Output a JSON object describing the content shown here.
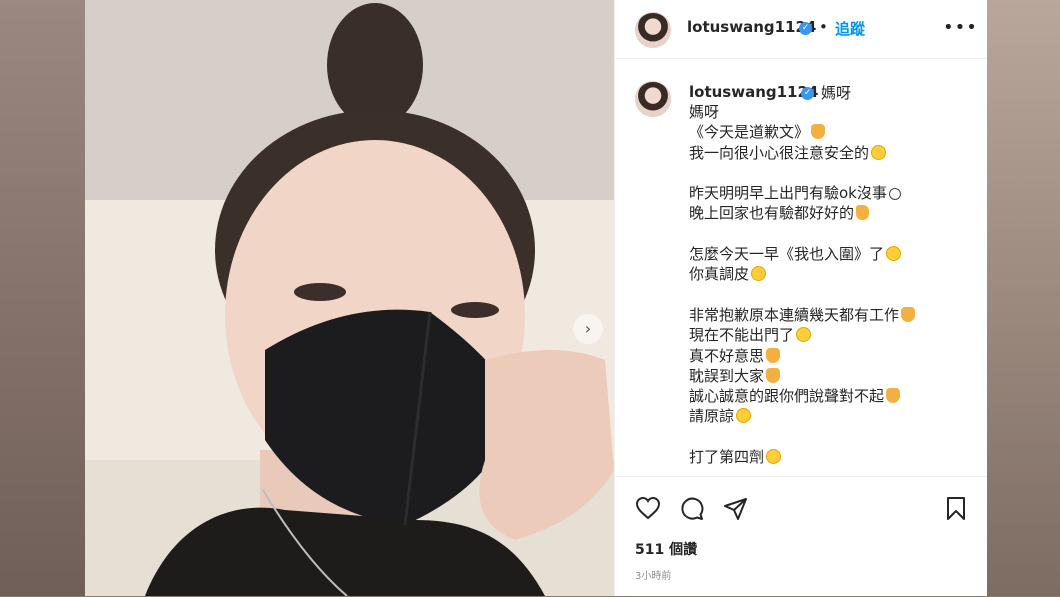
{
  "post": {
    "username": "lotuswang1124",
    "follow_label": "追蹤",
    "dot": "•",
    "more_label": "•••",
    "caption_first": "媽呀",
    "caption_lines": [
      {
        "text": "媽呀",
        "emoji": ""
      },
      {
        "text": "《今天是道歉文》",
        "emoji": "pray"
      },
      {
        "text": "我一向很小心很注意安全的",
        "emoji": "face"
      },
      {
        "text": "",
        "emoji": ""
      },
      {
        "text": "昨天明明早上出門有驗ok沒事",
        "emoji": "smile"
      },
      {
        "text": "晚上回家也有驗都好好的",
        "emoji": "ok"
      },
      {
        "text": "",
        "emoji": ""
      },
      {
        "text": "怎麼今天一早《我也入圍》了",
        "emoji": "face"
      },
      {
        "text": "你真調皮",
        "emoji": "face"
      },
      {
        "text": "",
        "emoji": ""
      },
      {
        "text": "非常抱歉原本連續幾天都有工作",
        "emoji": "pray"
      },
      {
        "text": "現在不能出門了",
        "emoji": "face"
      },
      {
        "text": "真不好意思",
        "emoji": "pray"
      },
      {
        "text": "耽誤到大家",
        "emoji": "pray"
      },
      {
        "text": "誠心誠意的跟你們說聲對不起",
        "emoji": "pray"
      },
      {
        "text": "請原諒",
        "emoji": "face"
      },
      {
        "text": "",
        "emoji": ""
      },
      {
        "text": "打了第四劑",
        "emoji": "face"
      }
    ],
    "likes": "511 個讚",
    "time_ago": "3小時前",
    "carousel_next": "›"
  },
  "colors": {
    "link_blue": "#0095f6",
    "verified_blue": "#3897f0",
    "text": "#262626",
    "muted": "#8e8e8e"
  },
  "icons": [
    "heart-icon",
    "comment-icon",
    "share-icon",
    "bookmark-icon",
    "verified-icon",
    "more-icon",
    "carousel-next-icon"
  ]
}
